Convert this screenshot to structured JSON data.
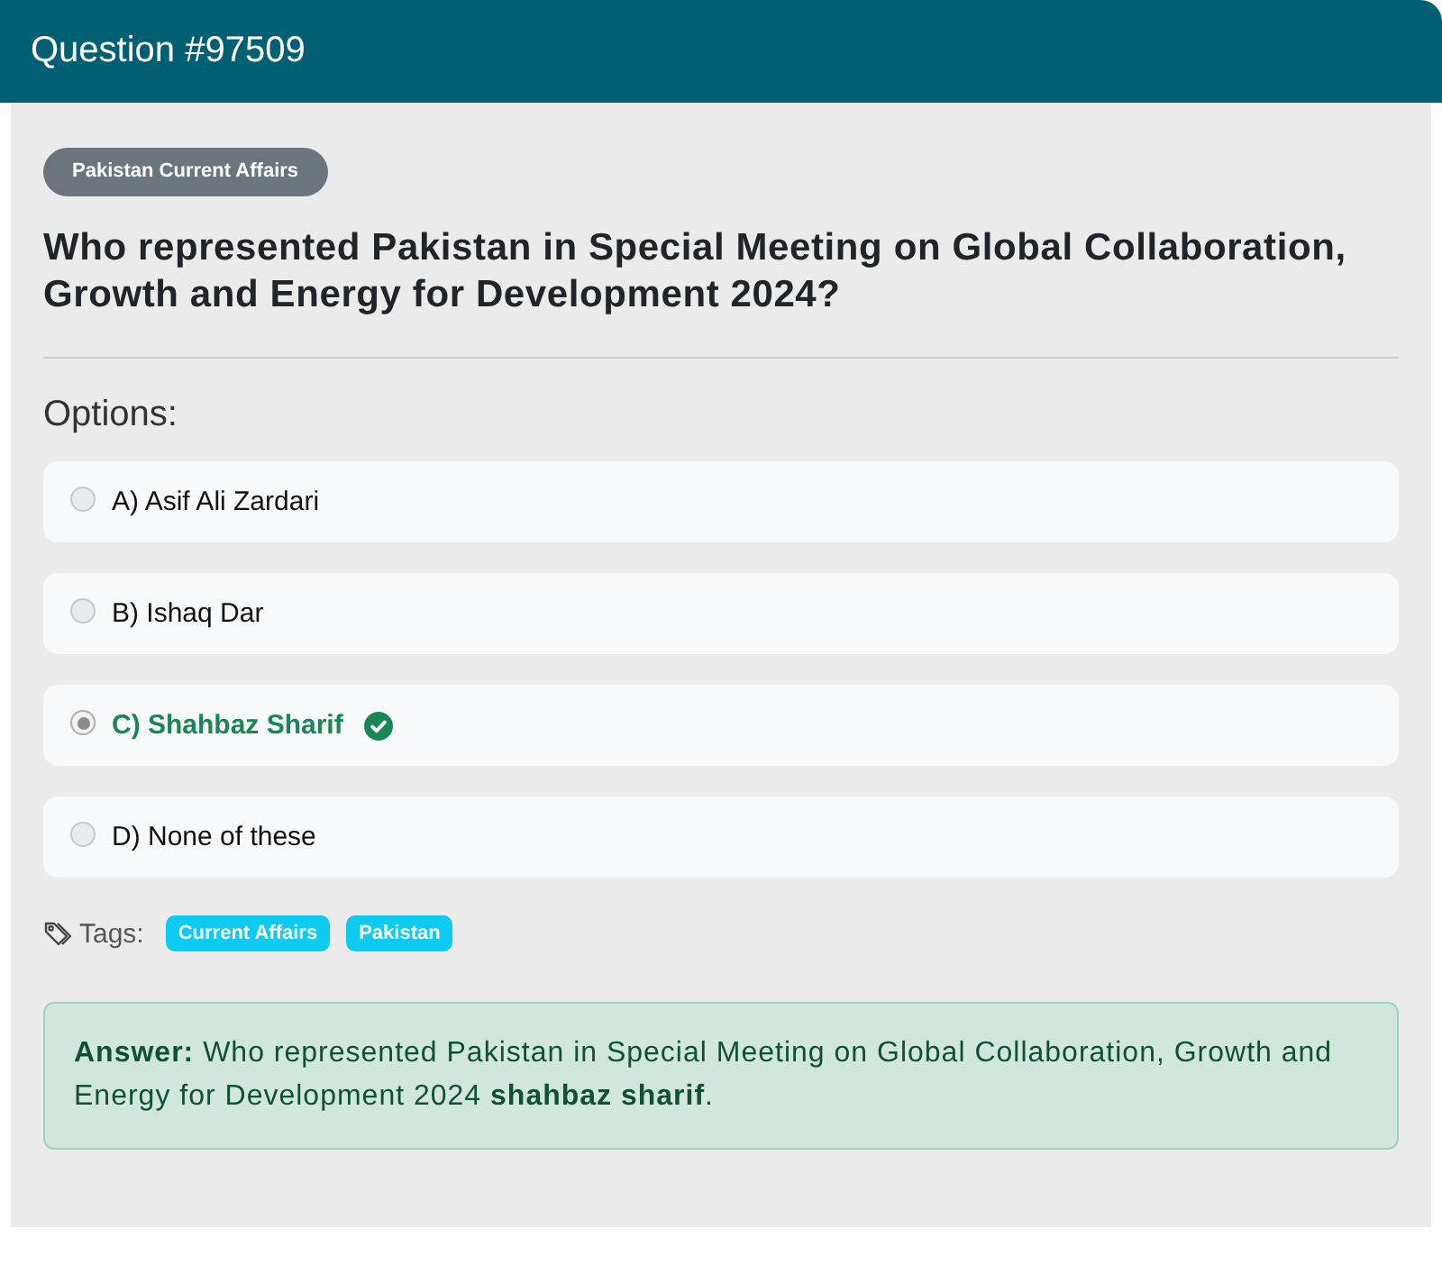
{
  "header": {
    "title": "Question #97509"
  },
  "category": {
    "label": "Pakistan Current Affairs"
  },
  "question": "Who represented Pakistan in Special Meeting on Global Collaboration, Growth and Energy for Development 2024?",
  "options_heading": "Options:",
  "options": [
    {
      "label": "A) Asif Ali Zardari",
      "selected": false,
      "correct": false
    },
    {
      "label": "B) Ishaq Dar",
      "selected": false,
      "correct": false
    },
    {
      "label": "C) Shahbaz Sharif",
      "selected": true,
      "correct": true
    },
    {
      "label": "D) None of these",
      "selected": false,
      "correct": false
    }
  ],
  "tags": {
    "label": "Tags:",
    "items": [
      "Current Affairs",
      "Pakistan"
    ]
  },
  "answer": {
    "text": "**Answer:** Who represented Pakistan in Special Meeting on Global Collaboration, Growth and Energy for Development 2024 **shahbaz sharif**."
  }
}
